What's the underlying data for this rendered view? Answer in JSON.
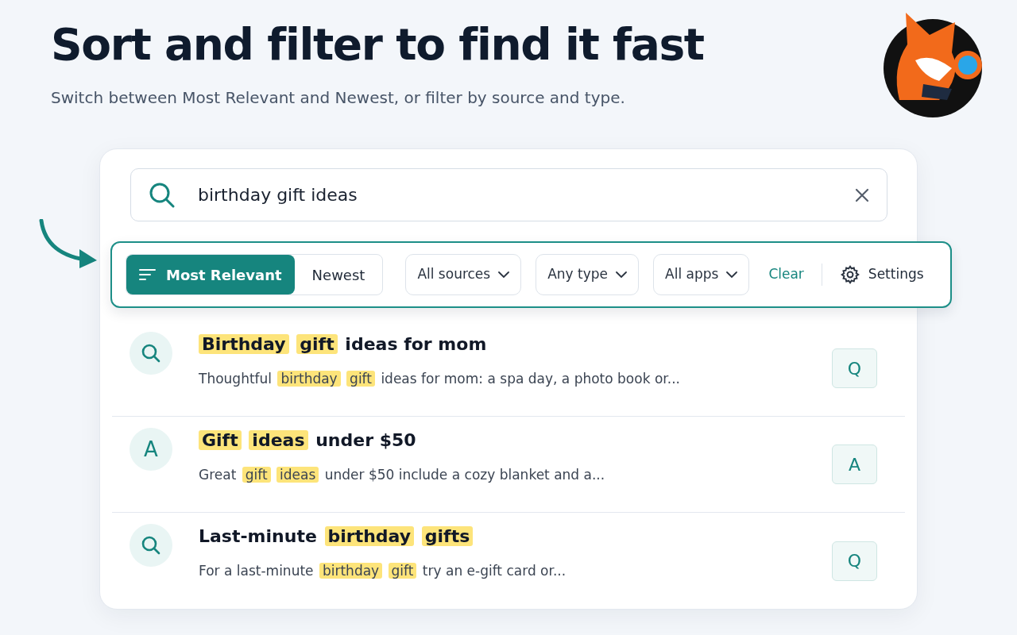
{
  "header": {
    "title": "Sort and filter to find it fast",
    "subtitle": "Switch between Most Relevant and Newest, or filter by source and type."
  },
  "search": {
    "value": "birthday gift ideas"
  },
  "sort_options": [
    {
      "label": "Most Relevant",
      "selected": true
    },
    {
      "label": "Newest",
      "selected": false
    }
  ],
  "filters": [
    {
      "label": "All sources"
    },
    {
      "label": "Any type"
    },
    {
      "label": "All apps"
    }
  ],
  "clear_link": "Clear",
  "settings_button": "Settings",
  "results": [
    {
      "icon": {
        "kind": "search"
      },
      "title": [
        {
          "text": "Birthday",
          "highlight": true
        },
        {
          "text": "gift",
          "highlight": true
        },
        {
          "text": "ideas for mom",
          "highlight": false
        }
      ],
      "snippet": [
        {
          "text": "Thoughtful",
          "highlight": false
        },
        {
          "text": "birthday",
          "highlight": true
        },
        {
          "text": "gift",
          "highlight": true
        },
        {
          "text": "ideas for mom: a spa day, a photo book or...",
          "highlight": false
        }
      ],
      "badge": "Q"
    },
    {
      "icon": {
        "kind": "letter",
        "text": "A"
      },
      "title": [
        {
          "text": "Gift",
          "highlight": true
        },
        {
          "text": "ideas",
          "highlight": true
        },
        {
          "text": "under $50",
          "highlight": false
        }
      ],
      "snippet": [
        {
          "text": "Great",
          "highlight": false
        },
        {
          "text": "gift",
          "highlight": true
        },
        {
          "text": "ideas",
          "highlight": true
        },
        {
          "text": "under $50 include a cozy blanket and a...",
          "highlight": false
        }
      ],
      "badge": "A"
    },
    {
      "icon": {
        "kind": "search"
      },
      "title": [
        {
          "text": "Last-minute",
          "highlight": false
        },
        {
          "text": "birthday",
          "highlight": true
        },
        {
          "text": "gifts",
          "highlight": true
        }
      ],
      "snippet": [
        {
          "text": "For a last-minute",
          "highlight": false
        },
        {
          "text": "birthday",
          "highlight": true
        },
        {
          "text": "gift",
          "highlight": true
        },
        {
          "text": "try an e-gift card or...",
          "highlight": false
        }
      ],
      "badge": "Q"
    }
  ]
}
